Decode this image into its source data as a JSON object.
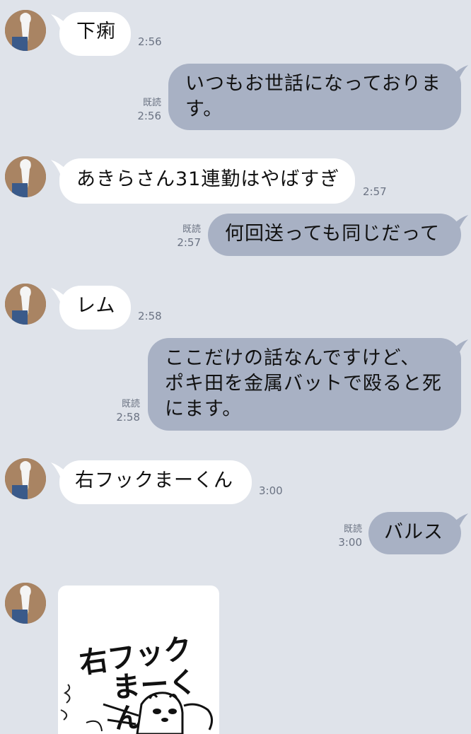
{
  "messages": [
    {
      "side": "in",
      "text": "下痢",
      "time": "2:56"
    },
    {
      "side": "out",
      "text": "いつもお世話になっておりま\nす。",
      "time": "2:56",
      "read": "既読"
    },
    {
      "side": "in",
      "text": "あきらさん31連勤はやばすぎ",
      "time": "2:57"
    },
    {
      "side": "out",
      "text": "何回送っても同じだって",
      "time": "2:57",
      "read": "既読"
    },
    {
      "side": "in",
      "text": "レム",
      "time": "2:58"
    },
    {
      "side": "out",
      "text": "ここだけの話なんですけど、\nポキ田を金属バットで殴ると死\nにます。",
      "time": "2:58",
      "read": "既読"
    },
    {
      "side": "in",
      "text": "右フックまーくん",
      "time": "3:00"
    },
    {
      "side": "out",
      "text": "バルス",
      "time": "3:00",
      "read": "既読"
    }
  ],
  "sticker": {
    "line1": "右フック",
    "line2": "まーくん"
  },
  "colors": {
    "background": "#dfe3ea",
    "incoming": "#ffffff",
    "outgoing": "#a8b1c4",
    "meta": "#6b7383"
  }
}
